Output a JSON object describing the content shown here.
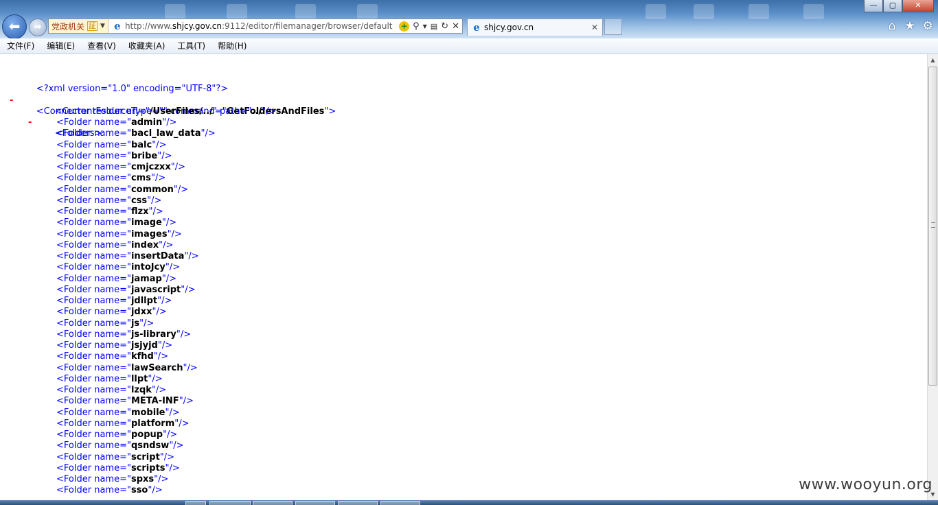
{
  "window": {
    "controls": {
      "minimize": "—",
      "maximize": "▢",
      "close": "✕"
    }
  },
  "address_bar": {
    "badge_text": "党政机关",
    "badge_seal": "証",
    "url_prefix": "http://www.",
    "url_domain": "shjcy.gov.cn",
    "url_rest": ":9112/editor/filemanager/browser/default"
  },
  "tab": {
    "title": "shjcy.gov.cn"
  },
  "menu": [
    "文件(F)",
    "编辑(E)",
    "查看(V)",
    "收藏夹(A)",
    "工具(T)",
    "帮助(H)"
  ],
  "xml": {
    "declaration": "<?xml version=\"1.0\" encoding=\"UTF-8\"?>",
    "connector_open_prefix": "<Connector resourceType=\"",
    "connector_mid": "\" command=\"",
    "connector_command": "GetFoldersAndFiles",
    "connector_close": "\">",
    "current_folder_prefix": "<CurrentFolder url=\"",
    "current_folder_url": "/UserFiles/../",
    "current_folder_mid": "\" path=\"",
    "current_folder_path": "../",
    "current_folder_close": "\"/>",
    "folders_open": "<Folders>",
    "folder_prefix": "<Folder name=\"",
    "folder_suffix": "\"/>",
    "minus": "-",
    "folders": [
      "admin",
      "bacl_law_data",
      "balc",
      "bribe",
      "cmjczxx",
      "cms",
      "common",
      "css",
      "flzx",
      "image",
      "images",
      "index",
      "insertData",
      "intoJcy",
      "jamap",
      "javascript",
      "jdllpt",
      "jdxx",
      "js",
      "js-library",
      "jsjyjd",
      "kfhd",
      "lawSearch",
      "llpt",
      "lzqk",
      "META-INF",
      "mobile",
      "platform",
      "popup",
      "qsndsw",
      "script",
      "scripts",
      "spxs",
      "sso"
    ]
  },
  "watermark": "www.wooyun.org",
  "icons": {
    "back": "arrow-left-icon",
    "forward": "arrow-right-icon",
    "home": "home-icon",
    "favorites": "star-icon",
    "tools": "gear-icon"
  }
}
